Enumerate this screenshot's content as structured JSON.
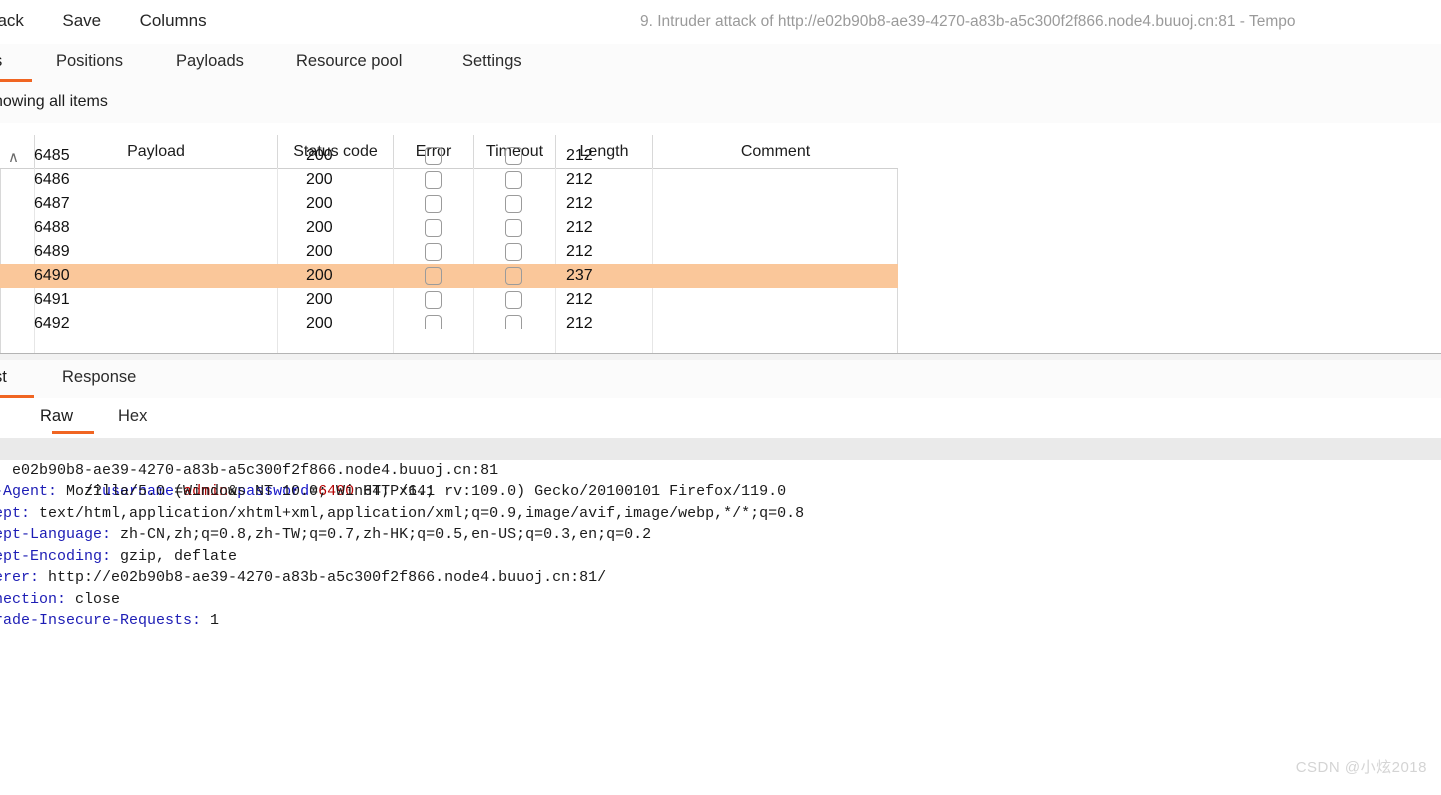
{
  "window": {
    "title": "9. Intruder attack of http://e02b90b8-ae39-4270-a83b-a5c300f2f866.node4.buuoj.cn:81 - Tempo",
    "menu": [
      {
        "label": "ttack"
      },
      {
        "label": "Save"
      },
      {
        "label": "Columns"
      }
    ]
  },
  "tabs": {
    "items": [
      {
        "label": "s",
        "active": true
      },
      {
        "label": "Positions",
        "active": false
      },
      {
        "label": "Payloads",
        "active": false
      },
      {
        "label": "Resource pool",
        "active": false
      },
      {
        "label": "Settings",
        "active": false
      }
    ],
    "accent": "#f06522"
  },
  "filter": {
    "text": "howing all items"
  },
  "results_table": {
    "sort_indicator": "∧",
    "columns": [
      {
        "key": "request",
        "label": ""
      },
      {
        "key": "payload",
        "label": "Payload"
      },
      {
        "key": "status",
        "label": "Status code"
      },
      {
        "key": "error",
        "label": "Error"
      },
      {
        "key": "timeout",
        "label": "Timeout"
      },
      {
        "key": "length",
        "label": "Length"
      },
      {
        "key": "comment",
        "label": "Comment"
      }
    ],
    "highlight_color": "#fac79a",
    "rows": [
      {
        "request": "6485",
        "payload": "",
        "status": "200",
        "error": false,
        "timeout": false,
        "length": "212",
        "comment": "",
        "highlight": false
      },
      {
        "request": "6486",
        "payload": "",
        "status": "200",
        "error": false,
        "timeout": false,
        "length": "212",
        "comment": "",
        "highlight": false
      },
      {
        "request": "6487",
        "payload": "",
        "status": "200",
        "error": false,
        "timeout": false,
        "length": "212",
        "comment": "",
        "highlight": false
      },
      {
        "request": "6488",
        "payload": "",
        "status": "200",
        "error": false,
        "timeout": false,
        "length": "212",
        "comment": "",
        "highlight": false
      },
      {
        "request": "6489",
        "payload": "",
        "status": "200",
        "error": false,
        "timeout": false,
        "length": "212",
        "comment": "",
        "highlight": false
      },
      {
        "request": "6490",
        "payload": "",
        "status": "200",
        "error": false,
        "timeout": false,
        "length": "237",
        "comment": "",
        "highlight": true
      },
      {
        "request": "6491",
        "payload": "",
        "status": "200",
        "error": false,
        "timeout": false,
        "length": "212",
        "comment": "",
        "highlight": false
      },
      {
        "request": "6492",
        "payload": "",
        "status": "200",
        "error": false,
        "timeout": false,
        "length": "212",
        "comment": "",
        "highlight": false
      }
    ]
  },
  "detail": {
    "tabs": [
      {
        "label": "st",
        "active": true
      },
      {
        "label": "Response",
        "active": false
      }
    ],
    "subtabs": [
      {
        "label": "Raw",
        "active": true
      },
      {
        "label": "Hex",
        "active": false
      }
    ],
    "request_line": {
      "prefix": "/?",
      "param1_name": "username",
      "eq": "=",
      "param1_value": "admin",
      "amp": "&",
      "param2_name": "password",
      "param2_value": "6490",
      "suffix": " HTTP/1.1"
    },
    "headers": [
      {
        "name": ":",
        "value": " e02b90b8-ae39-4270-a83b-a5c300f2f866.node4.buuoj.cn:81"
      },
      {
        "name": "-Agent:",
        "value": " Mozilla/5.0 (Windows NT 10.0; Win64; x64; rv:109.0) Gecko/20100101 Firefox/119.0"
      },
      {
        "name": "ept:",
        "value": " text/html,application/xhtml+xml,application/xml;q=0.9,image/avif,image/webp,*/*;q=0.8"
      },
      {
        "name": "ept-Language:",
        "value": " zh-CN,zh;q=0.8,zh-TW;q=0.7,zh-HK;q=0.5,en-US;q=0.3,en;q=0.2"
      },
      {
        "name": "ept-Encoding:",
        "value": " gzip, deflate"
      },
      {
        "name": "erer:",
        "value": " http://e02b90b8-ae39-4270-a83b-a5c300f2f866.node4.buuoj.cn:81/"
      },
      {
        "name": "nection:",
        "value": " close"
      },
      {
        "name": "rade-Insecure-Requests:",
        "value": " 1"
      }
    ]
  },
  "watermark": {
    "text": "CSDN @小炫2018"
  }
}
